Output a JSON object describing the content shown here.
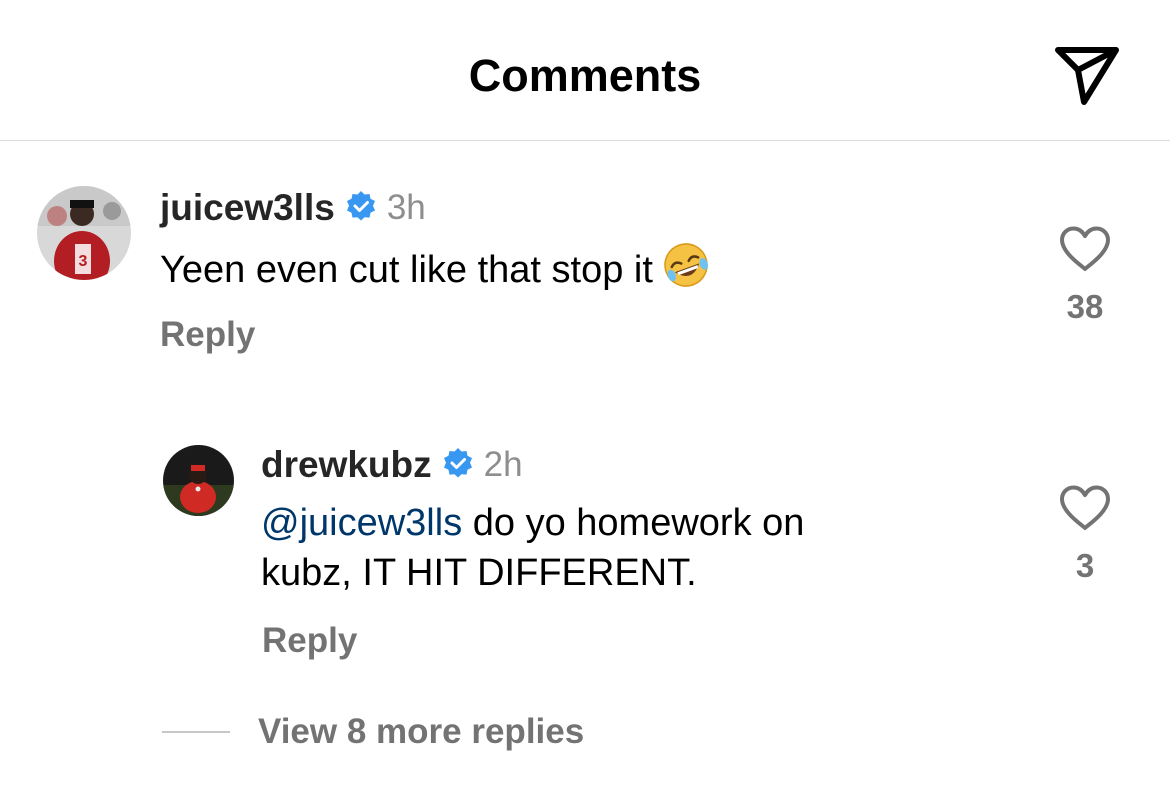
{
  "header": {
    "title": "Comments",
    "share_icon": "paper-plane-icon"
  },
  "comments": [
    {
      "username": "juicew3lls",
      "verified": true,
      "time": "3h",
      "text": "Yeen even cut like that stop it",
      "emoji": "🤣",
      "reply_label": "Reply",
      "likes": "38"
    },
    {
      "username": "drewkubz",
      "verified": true,
      "time": "2h",
      "mention": "@juicew3lls",
      "text_line1": " do yo homework on",
      "text_line2": "kubz, IT HIT DIFFERENT.",
      "reply_label": "Reply",
      "likes": "3"
    }
  ],
  "view_more": "View 8 more replies",
  "colors": {
    "verified": "#3897f0",
    "mention": "#00376b",
    "muted": "#737373"
  }
}
